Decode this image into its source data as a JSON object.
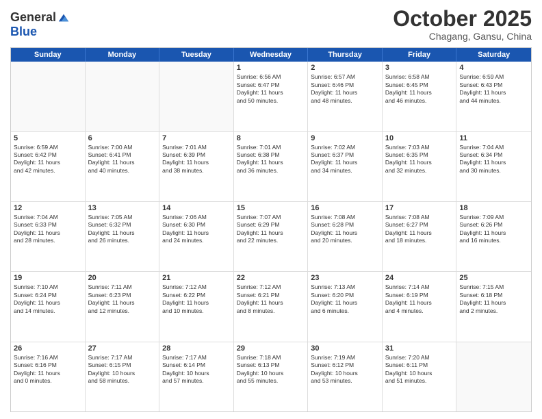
{
  "logo": {
    "general": "General",
    "blue": "Blue"
  },
  "header": {
    "month": "October 2025",
    "location": "Chagang, Gansu, China"
  },
  "days": [
    "Sunday",
    "Monday",
    "Tuesday",
    "Wednesday",
    "Thursday",
    "Friday",
    "Saturday"
  ],
  "weeks": [
    [
      {
        "day": "",
        "empty": true
      },
      {
        "day": "",
        "empty": true
      },
      {
        "day": "",
        "empty": true
      },
      {
        "day": "1",
        "lines": [
          "Sunrise: 6:56 AM",
          "Sunset: 6:47 PM",
          "Daylight: 11 hours",
          "and 50 minutes."
        ]
      },
      {
        "day": "2",
        "lines": [
          "Sunrise: 6:57 AM",
          "Sunset: 6:46 PM",
          "Daylight: 11 hours",
          "and 48 minutes."
        ]
      },
      {
        "day": "3",
        "lines": [
          "Sunrise: 6:58 AM",
          "Sunset: 6:45 PM",
          "Daylight: 11 hours",
          "and 46 minutes."
        ]
      },
      {
        "day": "4",
        "lines": [
          "Sunrise: 6:59 AM",
          "Sunset: 6:43 PM",
          "Daylight: 11 hours",
          "and 44 minutes."
        ]
      }
    ],
    [
      {
        "day": "5",
        "lines": [
          "Sunrise: 6:59 AM",
          "Sunset: 6:42 PM",
          "Daylight: 11 hours",
          "and 42 minutes."
        ]
      },
      {
        "day": "6",
        "lines": [
          "Sunrise: 7:00 AM",
          "Sunset: 6:41 PM",
          "Daylight: 11 hours",
          "and 40 minutes."
        ]
      },
      {
        "day": "7",
        "lines": [
          "Sunrise: 7:01 AM",
          "Sunset: 6:39 PM",
          "Daylight: 11 hours",
          "and 38 minutes."
        ]
      },
      {
        "day": "8",
        "lines": [
          "Sunrise: 7:01 AM",
          "Sunset: 6:38 PM",
          "Daylight: 11 hours",
          "and 36 minutes."
        ]
      },
      {
        "day": "9",
        "lines": [
          "Sunrise: 7:02 AM",
          "Sunset: 6:37 PM",
          "Daylight: 11 hours",
          "and 34 minutes."
        ]
      },
      {
        "day": "10",
        "lines": [
          "Sunrise: 7:03 AM",
          "Sunset: 6:35 PM",
          "Daylight: 11 hours",
          "and 32 minutes."
        ]
      },
      {
        "day": "11",
        "lines": [
          "Sunrise: 7:04 AM",
          "Sunset: 6:34 PM",
          "Daylight: 11 hours",
          "and 30 minutes."
        ]
      }
    ],
    [
      {
        "day": "12",
        "lines": [
          "Sunrise: 7:04 AM",
          "Sunset: 6:33 PM",
          "Daylight: 11 hours",
          "and 28 minutes."
        ]
      },
      {
        "day": "13",
        "lines": [
          "Sunrise: 7:05 AM",
          "Sunset: 6:32 PM",
          "Daylight: 11 hours",
          "and 26 minutes."
        ]
      },
      {
        "day": "14",
        "lines": [
          "Sunrise: 7:06 AM",
          "Sunset: 6:30 PM",
          "Daylight: 11 hours",
          "and 24 minutes."
        ]
      },
      {
        "day": "15",
        "lines": [
          "Sunrise: 7:07 AM",
          "Sunset: 6:29 PM",
          "Daylight: 11 hours",
          "and 22 minutes."
        ]
      },
      {
        "day": "16",
        "lines": [
          "Sunrise: 7:08 AM",
          "Sunset: 6:28 PM",
          "Daylight: 11 hours",
          "and 20 minutes."
        ]
      },
      {
        "day": "17",
        "lines": [
          "Sunrise: 7:08 AM",
          "Sunset: 6:27 PM",
          "Daylight: 11 hours",
          "and 18 minutes."
        ]
      },
      {
        "day": "18",
        "lines": [
          "Sunrise: 7:09 AM",
          "Sunset: 6:26 PM",
          "Daylight: 11 hours",
          "and 16 minutes."
        ]
      }
    ],
    [
      {
        "day": "19",
        "lines": [
          "Sunrise: 7:10 AM",
          "Sunset: 6:24 PM",
          "Daylight: 11 hours",
          "and 14 minutes."
        ]
      },
      {
        "day": "20",
        "lines": [
          "Sunrise: 7:11 AM",
          "Sunset: 6:23 PM",
          "Daylight: 11 hours",
          "and 12 minutes."
        ]
      },
      {
        "day": "21",
        "lines": [
          "Sunrise: 7:12 AM",
          "Sunset: 6:22 PM",
          "Daylight: 11 hours",
          "and 10 minutes."
        ]
      },
      {
        "day": "22",
        "lines": [
          "Sunrise: 7:12 AM",
          "Sunset: 6:21 PM",
          "Daylight: 11 hours",
          "and 8 minutes."
        ]
      },
      {
        "day": "23",
        "lines": [
          "Sunrise: 7:13 AM",
          "Sunset: 6:20 PM",
          "Daylight: 11 hours",
          "and 6 minutes."
        ]
      },
      {
        "day": "24",
        "lines": [
          "Sunrise: 7:14 AM",
          "Sunset: 6:19 PM",
          "Daylight: 11 hours",
          "and 4 minutes."
        ]
      },
      {
        "day": "25",
        "lines": [
          "Sunrise: 7:15 AM",
          "Sunset: 6:18 PM",
          "Daylight: 11 hours",
          "and 2 minutes."
        ]
      }
    ],
    [
      {
        "day": "26",
        "lines": [
          "Sunrise: 7:16 AM",
          "Sunset: 6:16 PM",
          "Daylight: 11 hours",
          "and 0 minutes."
        ]
      },
      {
        "day": "27",
        "lines": [
          "Sunrise: 7:17 AM",
          "Sunset: 6:15 PM",
          "Daylight: 10 hours",
          "and 58 minutes."
        ]
      },
      {
        "day": "28",
        "lines": [
          "Sunrise: 7:17 AM",
          "Sunset: 6:14 PM",
          "Daylight: 10 hours",
          "and 57 minutes."
        ]
      },
      {
        "day": "29",
        "lines": [
          "Sunrise: 7:18 AM",
          "Sunset: 6:13 PM",
          "Daylight: 10 hours",
          "and 55 minutes."
        ]
      },
      {
        "day": "30",
        "lines": [
          "Sunrise: 7:19 AM",
          "Sunset: 6:12 PM",
          "Daylight: 10 hours",
          "and 53 minutes."
        ]
      },
      {
        "day": "31",
        "lines": [
          "Sunrise: 7:20 AM",
          "Sunset: 6:11 PM",
          "Daylight: 10 hours",
          "and 51 minutes."
        ]
      },
      {
        "day": "",
        "empty": true
      }
    ]
  ]
}
